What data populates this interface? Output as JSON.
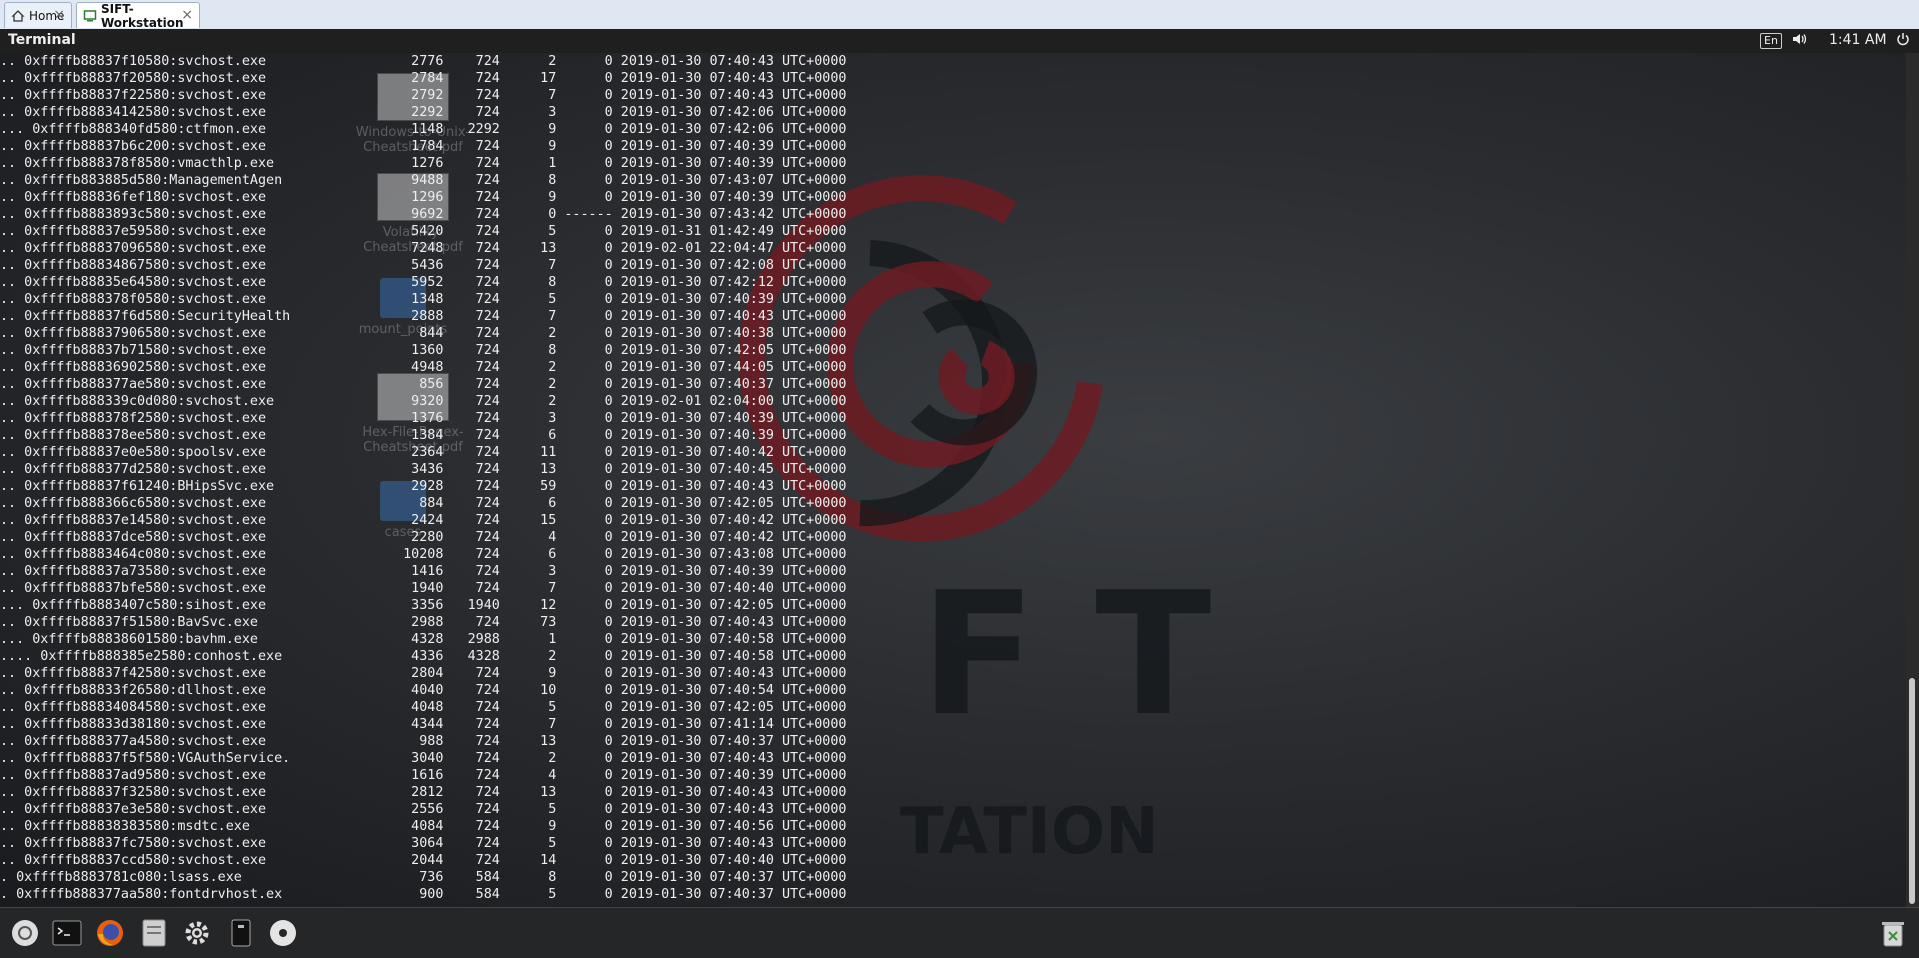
{
  "browser_tabs": [
    {
      "label": "Home",
      "icon": "home-icon"
    },
    {
      "label": "SIFT-Workstation",
      "icon": "vm-icon",
      "active": true
    }
  ],
  "panel": {
    "app_title": "Terminal",
    "keyboard_layout": "En",
    "clock": "1:41 AM",
    "icons": [
      "volume-icon",
      "power-icon"
    ]
  },
  "desktop_icons": [
    {
      "label": "Windows-to-Unix-Cheatsheet.pdf",
      "line1": "Windows-to-Unix-",
      "line2": "Cheatsheet.pdf",
      "kind": "pdf"
    },
    {
      "label": "Volatility-Cheatsheet.pdf",
      "line1": "Volatility-",
      "line2": "Cheatsheet.pdf",
      "kind": "pdf"
    },
    {
      "label": "mount_points",
      "line1": "mount_points",
      "line2": "",
      "kind": "folder"
    },
    {
      "label": "Hex-File-Regex-Cheatsheet.pdf",
      "line1": "Hex-File-Regex-",
      "line2": "Cheatsheet.pdf",
      "kind": "pdf"
    },
    {
      "label": "cases",
      "line1": "cases",
      "line2": "",
      "kind": "folder"
    }
  ],
  "wallpaper": {
    "logo_letters": "F T",
    "logo_subtitle": "TATION",
    "accent": "#7b1d24"
  },
  "terminal_lines": [
    ".. 0xffffb88837f10580:svchost.exe                  2776    724      2      0 2019-01-30 07:40:43 UTC+0000",
    ".. 0xffffb88837f20580:svchost.exe                  2784    724     17      0 2019-01-30 07:40:43 UTC+0000",
    ".. 0xffffb88837f22580:svchost.exe                  2792    724      7      0 2019-01-30 07:40:43 UTC+0000",
    ".. 0xffffb88834142580:svchost.exe                  2292    724      3      0 2019-01-30 07:42:06 UTC+0000",
    "... 0xffffb888340fd580:ctfmon.exe                  1148   2292      9      0 2019-01-30 07:42:06 UTC+0000",
    ".. 0xffffb88837b6c200:svchost.exe                  1784    724      9      0 2019-01-30 07:40:39 UTC+0000",
    ".. 0xffffb888378f8580:vmacthlp.exe                 1276    724      1      0 2019-01-30 07:40:39 UTC+0000",
    ".. 0xffffb883885d580:ManagementAgen                9488    724      8      0 2019-01-30 07:43:07 UTC+0000",
    ".. 0xffffb88836fef180:svchost.exe                  1296    724      9      0 2019-01-30 07:40:39 UTC+0000",
    ".. 0xffffb8883893c580:svchost.exe                  9692    724      0 ------ 2019-01-30 07:43:42 UTC+0000",
    ".. 0xffffb88837e59580:svchost.exe                  5420    724      5      0 2019-01-31 01:42:49 UTC+0000",
    ".. 0xffffb88837096580:svchost.exe                  7248    724     13      0 2019-02-01 22:04:47 UTC+0000",
    ".. 0xffffb88834867580:svchost.exe                  5436    724      7      0 2019-01-30 07:42:08 UTC+0000",
    ".. 0xffffb88835e64580:svchost.exe                  5952    724      8      0 2019-01-30 07:42:12 UTC+0000",
    ".. 0xffffb888378f0580:svchost.exe                  1348    724      5      0 2019-01-30 07:40:39 UTC+0000",
    ".. 0xffffb88837f6d580:SecurityHealth               2888    724      7      0 2019-01-30 07:40:43 UTC+0000",
    ".. 0xffffb88837906580:svchost.exe                   844    724      2      0 2019-01-30 07:40:38 UTC+0000",
    ".. 0xffffb88837b71580:svchost.exe                  1360    724      8      0 2019-01-30 07:42:05 UTC+0000",
    ".. 0xffffb88836902580:svchost.exe                  4948    724      2      0 2019-01-30 07:44:05 UTC+0000",
    ".. 0xffffb888377ae580:svchost.exe                   856    724      2      0 2019-01-30 07:40:37 UTC+0000",
    ".. 0xffffb888339c0d080:svchost.exe                 9320    724      2      0 2019-02-01 02:04:00 UTC+0000",
    ".. 0xffffb888378f2580:svchost.exe                  1376    724      3      0 2019-01-30 07:40:39 UTC+0000",
    ".. 0xffffb888378ee580:svchost.exe                  1384    724      6      0 2019-01-30 07:40:39 UTC+0000",
    ".. 0xffffb88837e0e580:spoolsv.exe                  2364    724     11      0 2019-01-30 07:40:42 UTC+0000",
    ".. 0xffffb888377d2580:svchost.exe                  3436    724     13      0 2019-01-30 07:40:45 UTC+0000",
    ".. 0xffffb88837f61240:BHipsSvc.exe                 2928    724     59      0 2019-01-30 07:40:43 UTC+0000",
    ".. 0xffffb888366c6580:svchost.exe                   884    724      6      0 2019-01-30 07:42:05 UTC+0000",
    ".. 0xffffb88837e14580:svchost.exe                  2424    724     15      0 2019-01-30 07:40:42 UTC+0000",
    ".. 0xffffb88837dce580:svchost.exe                  2280    724      4      0 2019-01-30 07:40:42 UTC+0000",
    ".. 0xffffb8883464c080:svchost.exe                 10208    724      6      0 2019-01-30 07:43:08 UTC+0000",
    ".. 0xffffb88837a73580:svchost.exe                  1416    724      3      0 2019-01-30 07:40:39 UTC+0000",
    ".. 0xffffb88837bfe580:svchost.exe                  1940    724      7      0 2019-01-30 07:40:40 UTC+0000",
    "... 0xffffb8883407c580:sihost.exe                  3356   1940     12      0 2019-01-30 07:42:05 UTC+0000",
    ".. 0xffffb88837f51580:BavSvc.exe                   2988    724     73      0 2019-01-30 07:40:43 UTC+0000",
    "... 0xffffb88838601580:bavhm.exe                   4328   2988      1      0 2019-01-30 07:40:58 UTC+0000",
    ".... 0xffffb888385e2580:conhost.exe                4336   4328      2      0 2019-01-30 07:40:58 UTC+0000",
    ".. 0xffffb88837f42580:svchost.exe                  2804    724      9      0 2019-01-30 07:40:43 UTC+0000",
    ".. 0xffffb88833f26580:dllhost.exe                  4040    724     10      0 2019-01-30 07:40:54 UTC+0000",
    ".. 0xffffb88834084580:svchost.exe                  4048    724      5      0 2019-01-30 07:42:05 UTC+0000",
    ".. 0xffffb88833d38180:svchost.exe                  4344    724      7      0 2019-01-30 07:41:14 UTC+0000",
    ".. 0xffffb888377a4580:svchost.exe                   988    724     13      0 2019-01-30 07:40:37 UTC+0000",
    ".. 0xffffb88837f5f580:VGAuthService.               3040    724      2      0 2019-01-30 07:40:43 UTC+0000",
    ".. 0xffffb88837ad9580:svchost.exe                  1616    724      4      0 2019-01-30 07:40:39 UTC+0000",
    ".. 0xffffb88837f32580:svchost.exe                  2812    724     13      0 2019-01-30 07:40:43 UTC+0000",
    ".. 0xffffb88837e3e580:svchost.exe                  2556    724      5      0 2019-01-30 07:40:43 UTC+0000",
    ".. 0xffffb88838383580:msdtc.exe                    4084    724      9      0 2019-01-30 07:40:56 UTC+0000",
    ".. 0xffffb88837fc7580:svchost.exe                  3064    724      5      0 2019-01-30 07:40:43 UTC+0000",
    ".. 0xffffb88837ccd580:svchost.exe                  2044    724     14      0 2019-01-30 07:40:40 UTC+0000",
    ". 0xffffb8883781c080:lsass.exe                      736    584      8      0 2019-01-30 07:40:37 UTC+0000",
    ". 0xffffb888377aa580:fontdrvhost.ex                 900    584      5      0 2019-01-30 07:40:37 UTC+0000"
  ],
  "dock_items": [
    {
      "name": "dash-home-icon"
    },
    {
      "name": "terminal-icon"
    },
    {
      "name": "firefox-icon"
    },
    {
      "name": "files-icon"
    },
    {
      "name": "settings-gear-icon"
    },
    {
      "name": "usb-drive-icon"
    },
    {
      "name": "disc-icon"
    },
    {
      "name": "trash-icon"
    }
  ]
}
